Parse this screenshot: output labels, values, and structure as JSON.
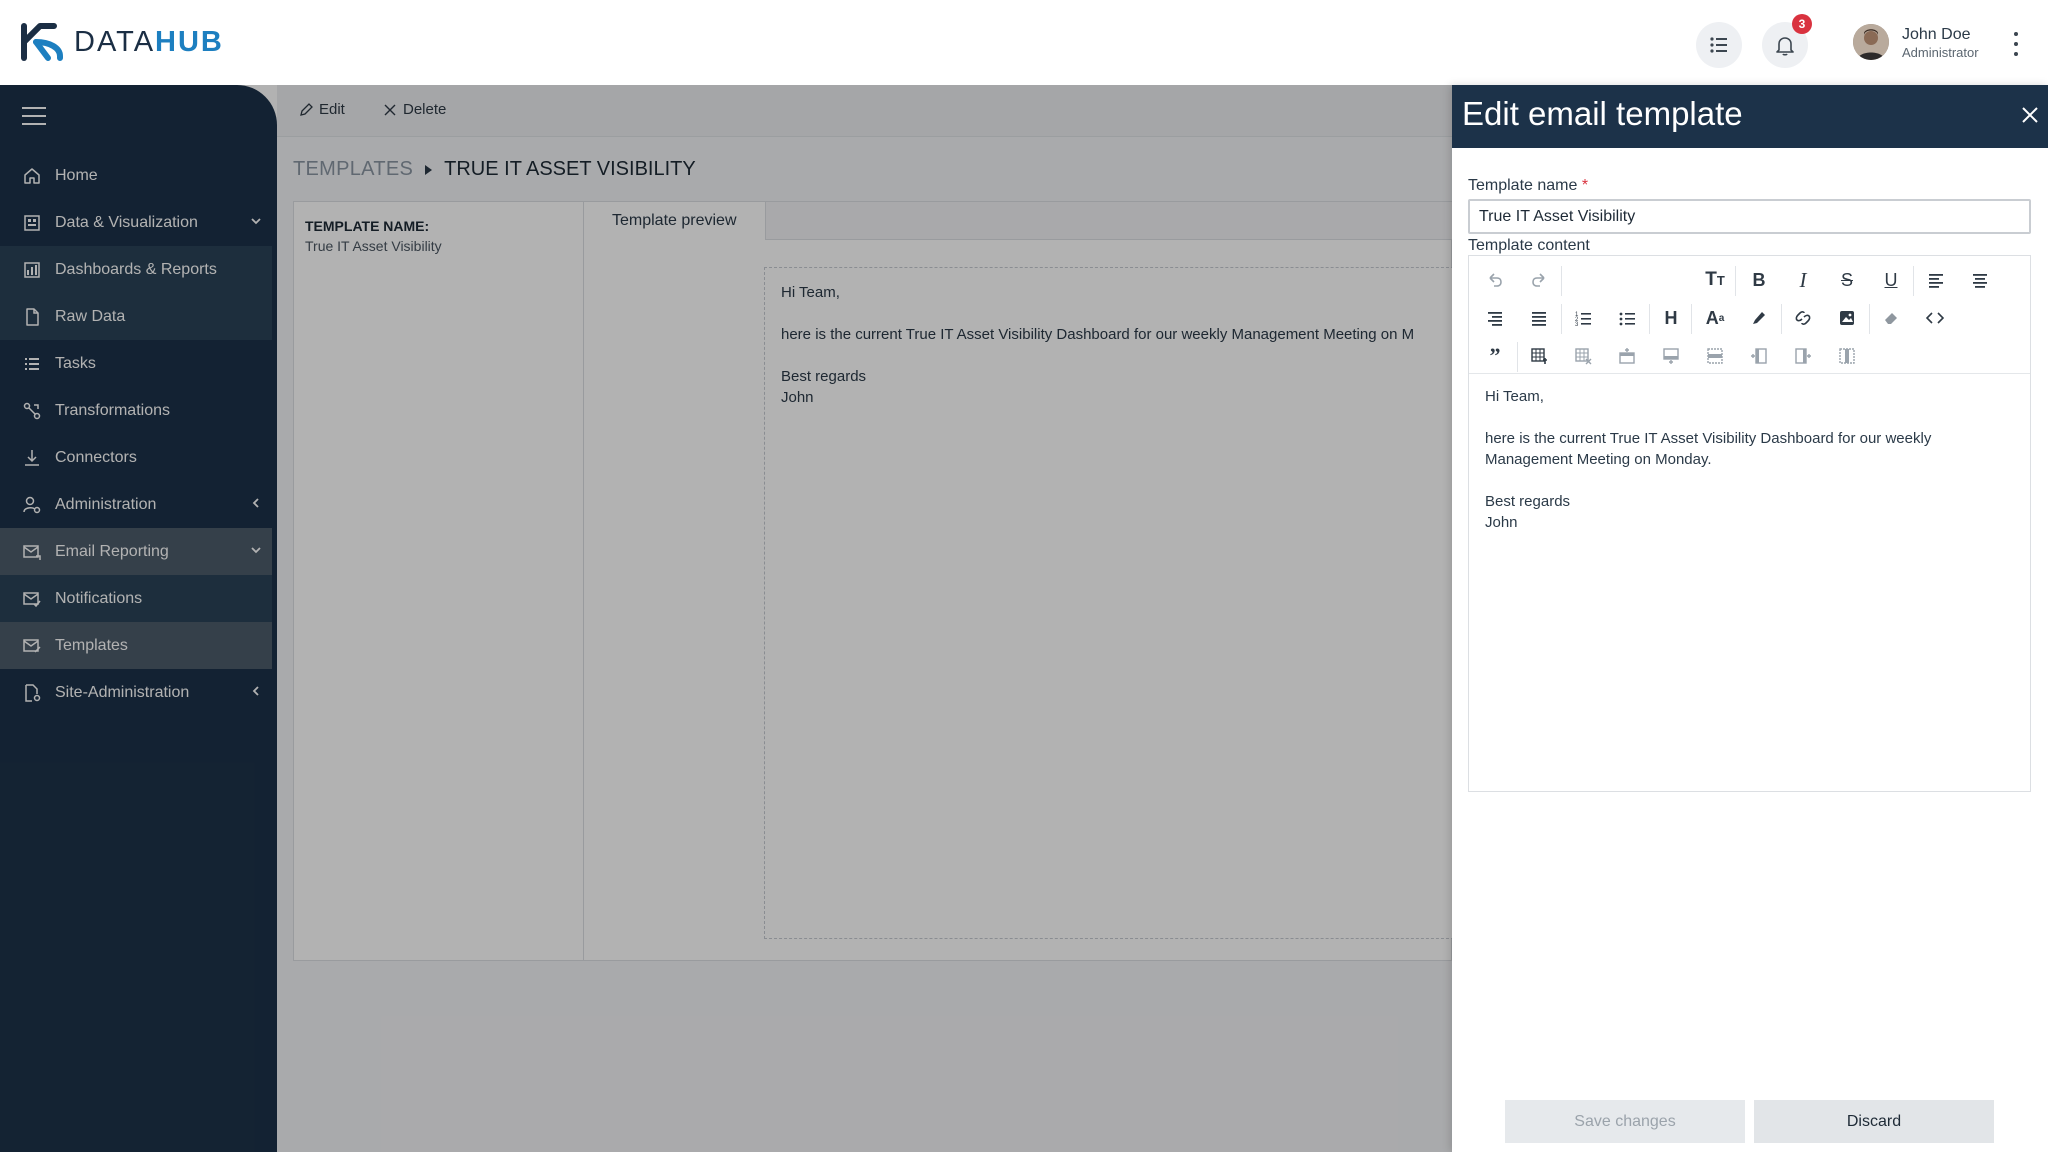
{
  "header": {
    "logo_text_a": "DATA",
    "logo_text_b": "HUB",
    "notification_count": "3",
    "user_name": "John Doe",
    "user_role": "Administrator",
    "brand_color": "#1d7fc0",
    "badge_color": "#d9323f"
  },
  "sidebar": {
    "items": [
      {
        "label": "Home",
        "icon": "home-icon"
      },
      {
        "label": "Data & Visualization",
        "icon": "building-icon",
        "arrow": "chevron-down"
      },
      {
        "label": "Dashboards & Reports",
        "icon": "dashboard-icon"
      },
      {
        "label": "Raw Data",
        "icon": "file-icon"
      },
      {
        "label": "Tasks",
        "icon": "list-icon"
      },
      {
        "label": "Transformations",
        "icon": "transform-icon"
      },
      {
        "label": "Connectors",
        "icon": "download-icon"
      },
      {
        "label": "Administration",
        "icon": "user-gear-icon",
        "arrow": "chevron-left"
      },
      {
        "label": "Email Reporting",
        "icon": "mail-icon",
        "arrow": "chevron-down"
      },
      {
        "label": "Notifications",
        "icon": "mail-check-icon"
      },
      {
        "label": "Templates",
        "icon": "mail-template-icon"
      },
      {
        "label": "Site-Administration",
        "icon": "file-gear-icon",
        "arrow": "chevron-left"
      }
    ]
  },
  "toolbar": {
    "edit_label": "Edit",
    "delete_label": "Delete"
  },
  "breadcrumb": {
    "root": "TEMPLATES",
    "current": "TRUE IT ASSET VISIBILITY"
  },
  "template_meta": {
    "label": "TEMPLATE NAME:",
    "value": "True IT Asset Visibility"
  },
  "preview": {
    "tab_label": "Template preview",
    "greeting": "Hi Team,",
    "body": "here is the current True IT Asset Visibility Dashboard for our weekly Management Meeting on M",
    "closing": "Best regards",
    "signature": "John"
  },
  "drawer": {
    "title": "Edit email template",
    "name_label": "Template name",
    "required_mark": "*",
    "name_value": "True IT Asset Visibility",
    "content_label": "Template content",
    "editor": {
      "greeting": "Hi Team,",
      "body_line1": "here is the current True IT Asset Visibility Dashboard for our weekly",
      "body_line2": "Management Meeting on Monday.",
      "closing": "Best regards",
      "signature": "John"
    },
    "save_label": "Save changes",
    "discard_label": "Discard"
  }
}
